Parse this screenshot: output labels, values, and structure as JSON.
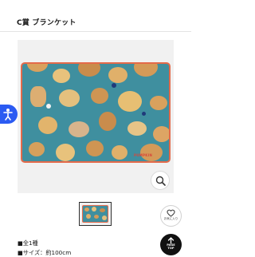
{
  "header": {
    "title": "C賞 ブランケット"
  },
  "accessibility": {
    "icon": "accessibility-person-icon",
    "color": "#2b5bf2"
  },
  "product_image": {
    "blanket_color": "#3f8f9f",
    "border_color": "#e46a4a",
    "logo_text": "PUMPKIN"
  },
  "zoom": {
    "icon": "magnifier-icon"
  },
  "favorite": {
    "label": "お気に入り",
    "icon": "heart-icon"
  },
  "page_top": {
    "label_line1": "PAGE",
    "label_line2": "TOP",
    "icon": "arrow-up-icon"
  },
  "details": {
    "items": [
      {
        "bullet": "■",
        "text": "全1種"
      },
      {
        "bullet": "■",
        "text": "サイズ：約100cm"
      }
    ]
  }
}
